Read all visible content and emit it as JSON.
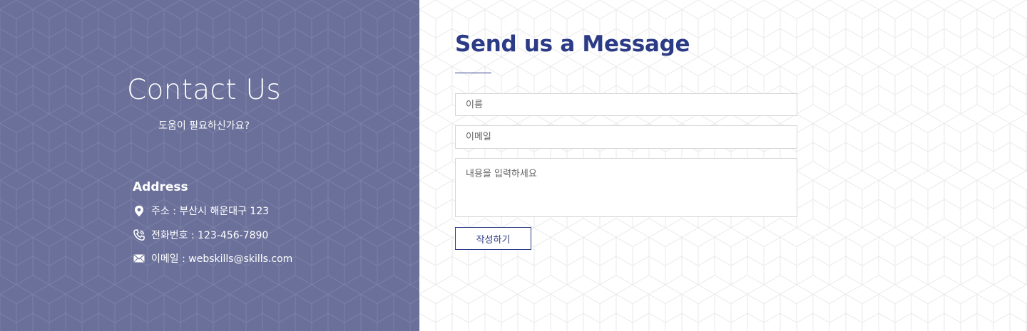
{
  "contact": {
    "title": "Contact Us",
    "subtitle": "도움이 필요하신가요?",
    "address_heading": "Address",
    "items": [
      {
        "icon": "map-pin-icon",
        "text": "주소 : 부산시 해운대구 123"
      },
      {
        "icon": "phone-icon",
        "text": "전화번호 : 123-456-7890"
      },
      {
        "icon": "mail-icon",
        "text": "이메일 : webskills@skills.com"
      }
    ]
  },
  "form": {
    "title": "Send us a Message",
    "name_placeholder": "이름",
    "email_placeholder": "이메일",
    "message_placeholder": "내용을 입력하세요",
    "submit_label": "작성하기"
  },
  "colors": {
    "left_panel_bg": "#6a7099",
    "accent": "#2c3b86",
    "right_panel_bg": "#ffffff"
  }
}
